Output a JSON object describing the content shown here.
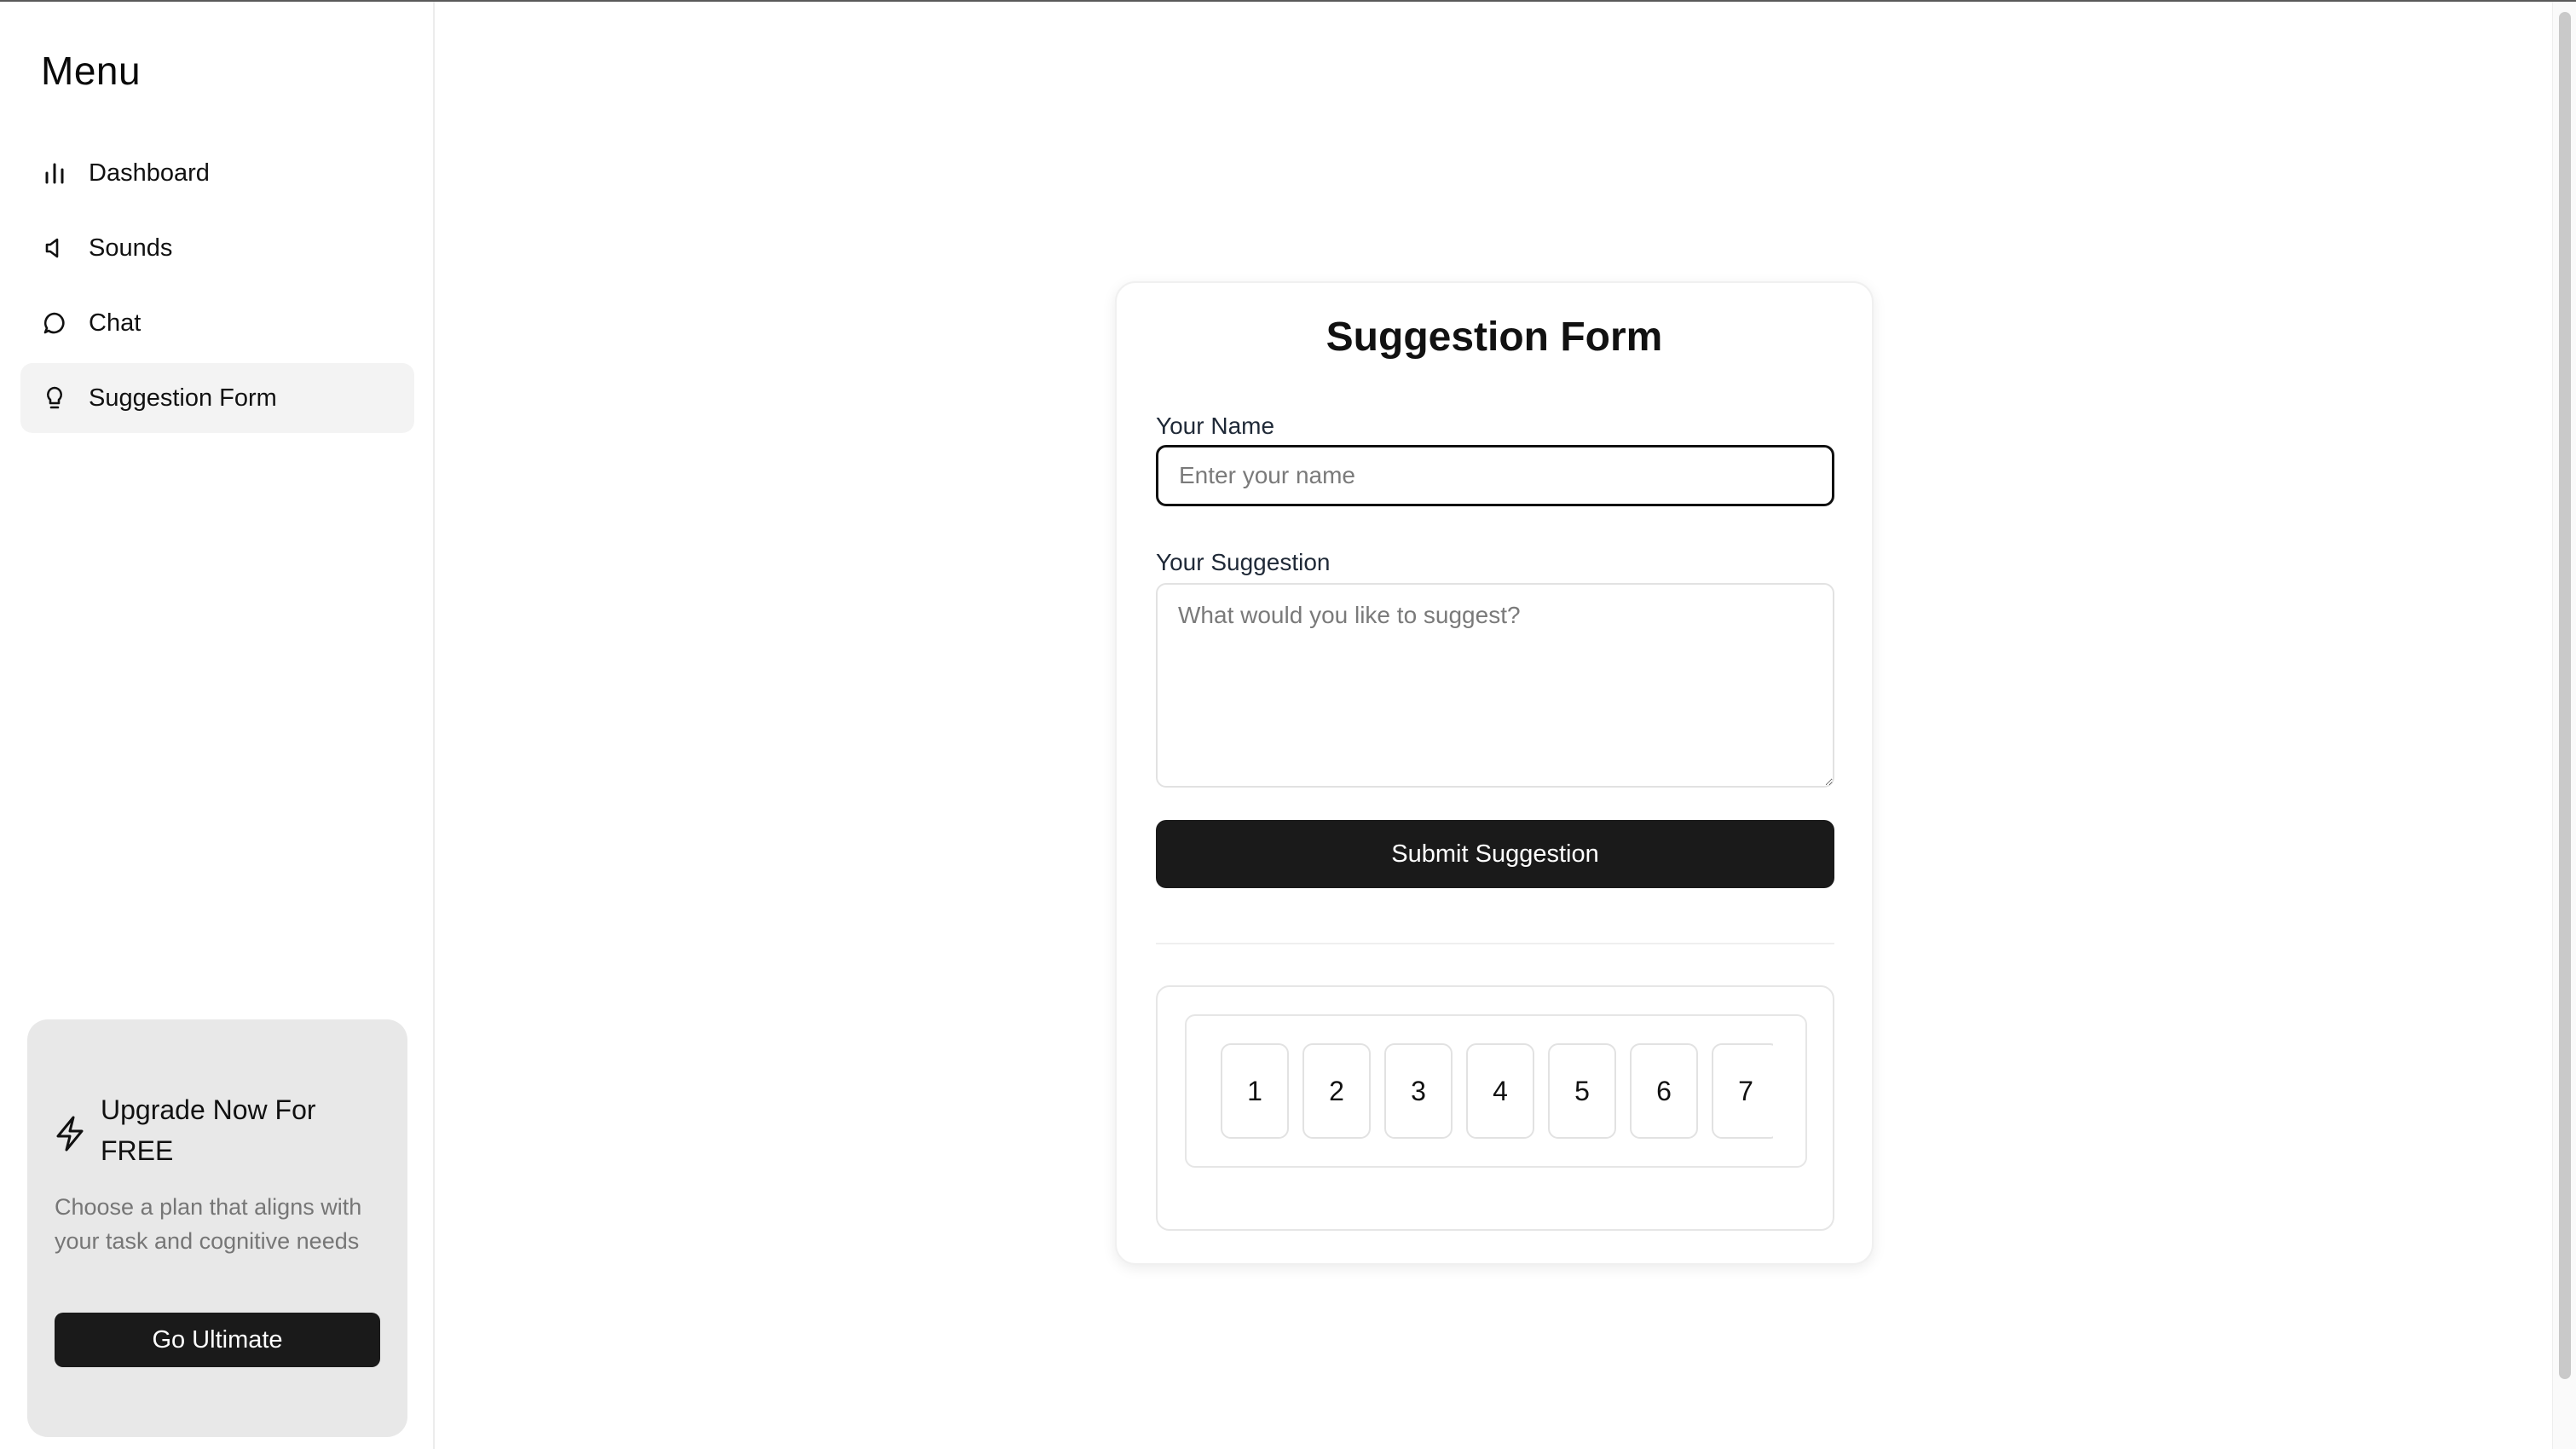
{
  "sidebar": {
    "title": "Menu",
    "items": [
      {
        "label": "Dashboard",
        "icon": "bar-chart-icon"
      },
      {
        "label": "Sounds",
        "icon": "speaker-icon"
      },
      {
        "label": "Chat",
        "icon": "chat-bubble-icon"
      },
      {
        "label": "Suggestion Form",
        "icon": "lightbulb-icon",
        "active": true
      }
    ],
    "upgrade": {
      "title": "Upgrade Now For FREE",
      "description": "Choose a plan that aligns with your task and cognitive needs",
      "button_label": "Go Ultimate"
    }
  },
  "form": {
    "title": "Suggestion Form",
    "name_label": "Your Name",
    "name_placeholder": "Enter your name",
    "name_value": "",
    "suggestion_label": "Your Suggestion",
    "suggestion_placeholder": "What would you like to suggest?",
    "suggestion_value": "",
    "submit_label": "Submit Suggestion"
  },
  "digits": [
    "1",
    "2",
    "3",
    "4",
    "5",
    "6",
    "7"
  ],
  "colors": {
    "primary_button": "#1a1a1a",
    "active_nav_bg": "#f3f3f3",
    "upgrade_card_bg": "#e8e8e8"
  }
}
